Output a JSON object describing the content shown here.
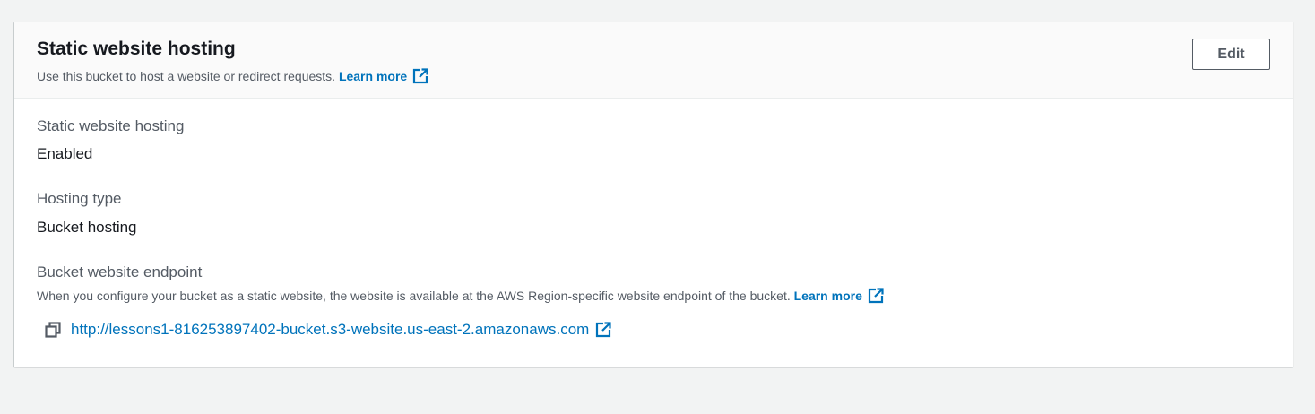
{
  "panel": {
    "title": "Static website hosting",
    "description": "Use this bucket to host a website or redirect requests.",
    "learn_more": "Learn more",
    "edit_label": "Edit"
  },
  "fields": {
    "hosting": {
      "label": "Static website hosting",
      "value": "Enabled"
    },
    "hosting_type": {
      "label": "Hosting type",
      "value": "Bucket hosting"
    },
    "endpoint": {
      "label": "Bucket website endpoint",
      "description": "When you configure your bucket as a static website, the website is available at the AWS Region-specific website endpoint of the bucket.",
      "learn_more": "Learn more",
      "url": "http://lessons1-816253897402-bucket.s3-website.us-east-2.amazonaws.com"
    }
  },
  "icons": {
    "external_link": "external-link-icon",
    "copy": "copy-icon"
  },
  "colors": {
    "link": "#0073bb",
    "text": "#16191f",
    "secondary_text": "#545b64",
    "header_bg": "#fafafa",
    "page_bg": "#f2f3f3"
  }
}
